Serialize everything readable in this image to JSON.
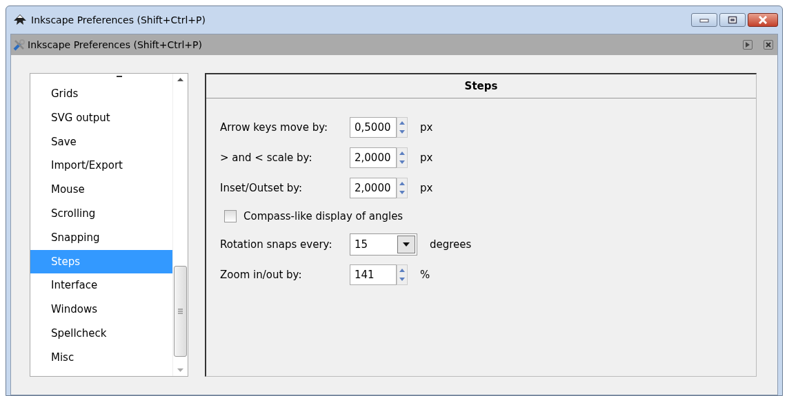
{
  "window": {
    "title": "Inkscape Preferences (Shift+Ctrl+P)"
  },
  "dock_title": "Inkscape Preferences (Shift+Ctrl+P)",
  "sidebar": {
    "items": [
      {
        "label": "Grids",
        "selected": false
      },
      {
        "label": "SVG output",
        "selected": false
      },
      {
        "label": "Save",
        "selected": false
      },
      {
        "label": "Import/Export",
        "selected": false
      },
      {
        "label": "Mouse",
        "selected": false
      },
      {
        "label": "Scrolling",
        "selected": false
      },
      {
        "label": "Snapping",
        "selected": false
      },
      {
        "label": "Steps",
        "selected": true
      },
      {
        "label": "Interface",
        "selected": false
      },
      {
        "label": "Windows",
        "selected": false
      },
      {
        "label": "Spellcheck",
        "selected": false
      },
      {
        "label": "Misc",
        "selected": false
      }
    ]
  },
  "panel": {
    "title": "Steps",
    "settings": [
      {
        "kind": "spin",
        "label": "Arrow keys move by:",
        "value": "0,5000",
        "unit": "px"
      },
      {
        "kind": "spin",
        "label": "> and < scale by:",
        "value": "2,0000",
        "unit": "px"
      },
      {
        "kind": "spin",
        "label": "Inset/Outset by:",
        "value": "2,0000",
        "unit": "px"
      },
      {
        "kind": "checkbox",
        "label": "Compass-like display of angles",
        "checked": false
      },
      {
        "kind": "combo",
        "label": "Rotation snaps every:",
        "value": "15",
        "unit": "degrees"
      },
      {
        "kind": "spin",
        "label": "Zoom in/out by:",
        "value": "141",
        "unit": "%"
      }
    ]
  }
}
